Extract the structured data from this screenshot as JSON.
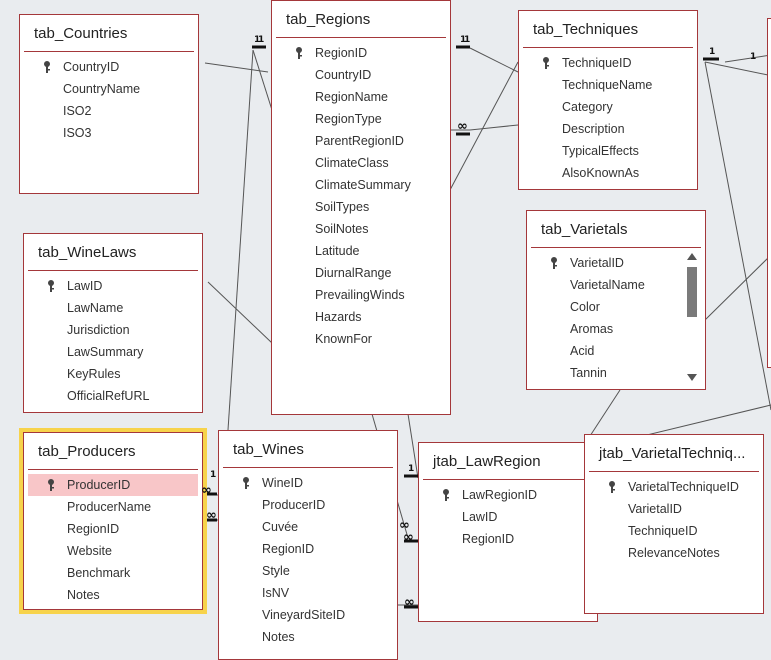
{
  "tables": {
    "countries": {
      "title": "tab_Countries",
      "fields": [
        "CountryID",
        "CountryName",
        "ISO2",
        "ISO3"
      ]
    },
    "regions": {
      "title": "tab_Regions",
      "fields": [
        "RegionID",
        "CountryID",
        "RegionName",
        "RegionType",
        "ParentRegionID",
        "ClimateClass",
        "ClimateSummary",
        "SoilTypes",
        "SoilNotes",
        "Latitude",
        "DiurnalRange",
        "PrevailingWinds",
        "Hazards",
        "KnownFor"
      ]
    },
    "techniques": {
      "title": "tab_Techniques",
      "fields": [
        "TechniqueID",
        "TechniqueName",
        "Category",
        "Description",
        "TypicalEffects",
        "AlsoKnownAs"
      ]
    },
    "winelaws": {
      "title": "tab_WineLaws",
      "fields": [
        "LawID",
        "LawName",
        "Jurisdiction",
        "LawSummary",
        "KeyRules",
        "OfficialRefURL"
      ]
    },
    "varietals": {
      "title": "tab_Varietals",
      "fields": [
        "VarietalID",
        "VarietalName",
        "Color",
        "Aromas",
        "Acid",
        "Tannin"
      ]
    },
    "producers": {
      "title": "tab_Producers",
      "fields": [
        "ProducerID",
        "ProducerName",
        "RegionID",
        "Website",
        "Benchmark",
        "Notes"
      ]
    },
    "wines": {
      "title": "tab_Wines",
      "fields": [
        "WineID",
        "ProducerID",
        "Cuvée",
        "RegionID",
        "Style",
        "IsNV",
        "VineyardSiteID",
        "Notes"
      ]
    },
    "lawregion": {
      "title": "jtab_LawRegion",
      "fields": [
        "LawRegionID",
        "LawID",
        "RegionID"
      ]
    },
    "varietaltech": {
      "title": "jtab_VarietalTechniq...",
      "fields": [
        "VarietalTechniqueID",
        "VarietalID",
        "TechniqueID",
        "RelevanceNotes"
      ]
    }
  },
  "relationship_labels": {
    "one": "1",
    "many": "∞"
  }
}
